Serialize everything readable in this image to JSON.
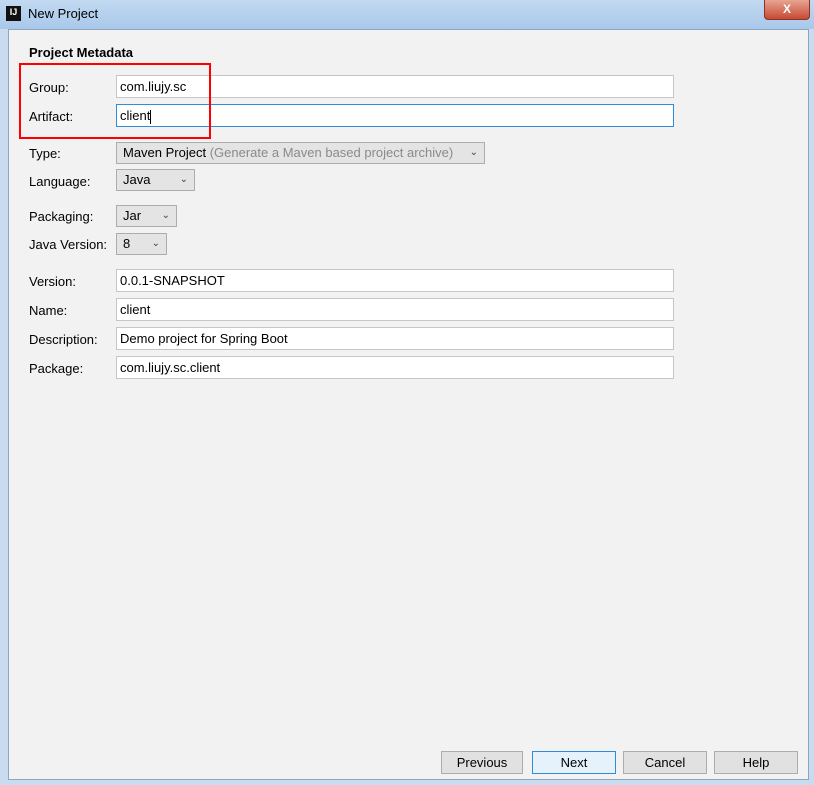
{
  "window": {
    "title": "New Project",
    "icon_text": "IJ",
    "close_label": "X"
  },
  "heading": "Project Metadata",
  "fields": {
    "group": {
      "label": "Group:",
      "value": "com.liujy.sc"
    },
    "artifact": {
      "label": "Artifact:",
      "value": "client"
    },
    "type": {
      "label": "Type:",
      "value": "Maven Project",
      "hint": "(Generate a Maven based project archive)"
    },
    "language": {
      "label": "Language:",
      "value": "Java"
    },
    "packaging": {
      "label": "Packaging:",
      "value": "Jar"
    },
    "java_version": {
      "label": "Java Version:",
      "value": "8"
    },
    "version": {
      "label": "Version:",
      "value": "0.0.1-SNAPSHOT"
    },
    "name": {
      "label": "Name:",
      "value": "client"
    },
    "description": {
      "label": "Description:",
      "value": "Demo project for Spring Boot"
    },
    "package": {
      "label": "Package:",
      "value": "com.liujy.sc.client"
    }
  },
  "buttons": {
    "previous": "Previous",
    "next": "Next",
    "cancel": "Cancel",
    "help": "Help"
  },
  "colors": {
    "highlight": "#ff0000",
    "focus": "#2f8cd9"
  }
}
